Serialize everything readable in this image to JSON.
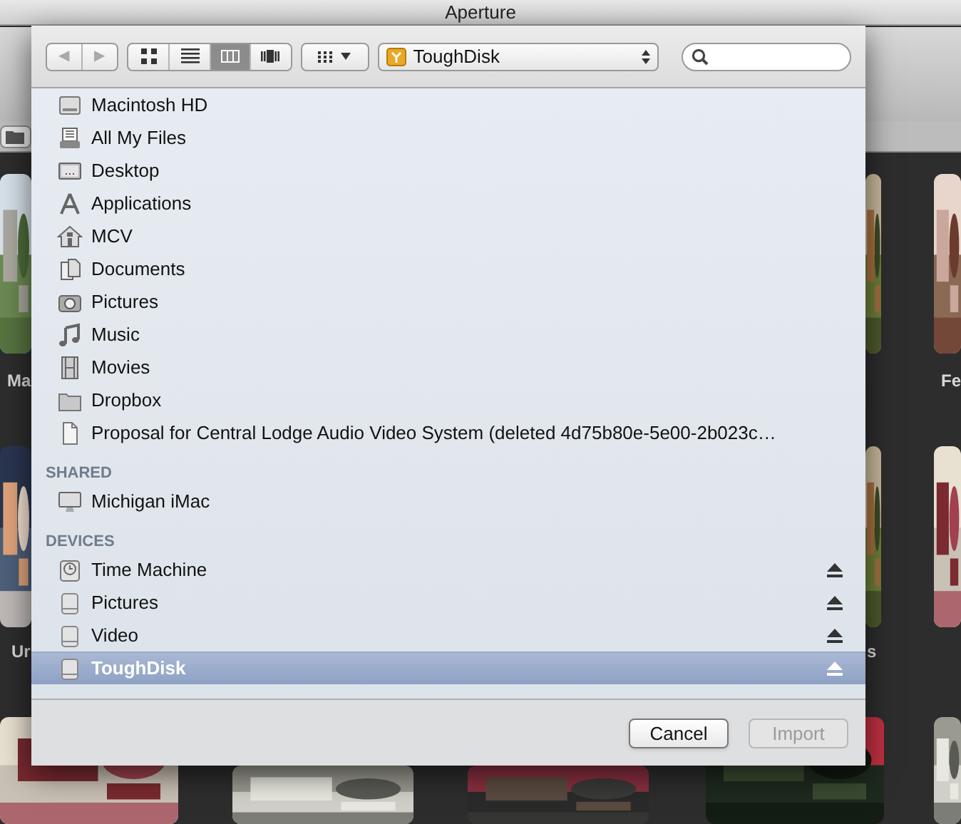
{
  "window": {
    "title": "Aperture"
  },
  "background": {
    "captions": [
      "Ma",
      "Fe",
      "Ur",
      "s"
    ]
  },
  "sheet": {
    "toolbar": {
      "nav": [
        {
          "label": "◀",
          "disabled": true
        },
        {
          "label": "▶",
          "disabled": true
        }
      ],
      "views": [
        {
          "kind": "icons",
          "selected": false
        },
        {
          "kind": "list",
          "selected": false
        },
        {
          "kind": "columns",
          "selected": true
        },
        {
          "kind": "coverflow",
          "selected": false
        }
      ],
      "location": "ToughDisk"
    },
    "sidebar": [
      {
        "items": [
          {
            "label": "Macintosh HD",
            "kind": "drive",
            "selected": false,
            "eject": false
          },
          {
            "label": "All My Files",
            "kind": "files",
            "selected": false,
            "eject": false
          },
          {
            "label": "Desktop",
            "kind": "desktop",
            "selected": false,
            "eject": false
          },
          {
            "label": "Applications",
            "kind": "apps",
            "selected": false,
            "eject": false
          },
          {
            "label": "MCV",
            "kind": "home",
            "selected": false,
            "eject": false
          },
          {
            "label": "Documents",
            "kind": "docs",
            "selected": false,
            "eject": false
          },
          {
            "label": "Pictures",
            "kind": "camera",
            "selected": false,
            "eject": false
          },
          {
            "label": "Music",
            "kind": "music",
            "selected": false,
            "eject": false
          },
          {
            "label": "Movies",
            "kind": "film",
            "selected": false,
            "eject": false
          },
          {
            "label": "Dropbox",
            "kind": "folder",
            "selected": false,
            "eject": false
          },
          {
            "label": "Proposal for Central Lodge Audio Video System (deleted 4d75b80e-5e00-2b023c…",
            "kind": "file",
            "selected": false,
            "eject": false
          }
        ]
      },
      {
        "header": "SHARED",
        "items": [
          {
            "label": "Michigan iMac",
            "kind": "imac",
            "selected": false,
            "eject": false
          }
        ]
      },
      {
        "header": "DEVICES",
        "items": [
          {
            "label": "Time Machine",
            "kind": "timemachine",
            "selected": false,
            "eject": true
          },
          {
            "label": "Pictures",
            "kind": "disk",
            "selected": false,
            "eject": true
          },
          {
            "label": "Video",
            "kind": "disk",
            "selected": false,
            "eject": true
          },
          {
            "label": "ToughDisk",
            "kind": "disk",
            "selected": true,
            "eject": true
          }
        ]
      }
    ],
    "buttons": [
      {
        "label": "Cancel",
        "disabled": false
      },
      {
        "label": "Import",
        "disabled": true
      }
    ]
  }
}
